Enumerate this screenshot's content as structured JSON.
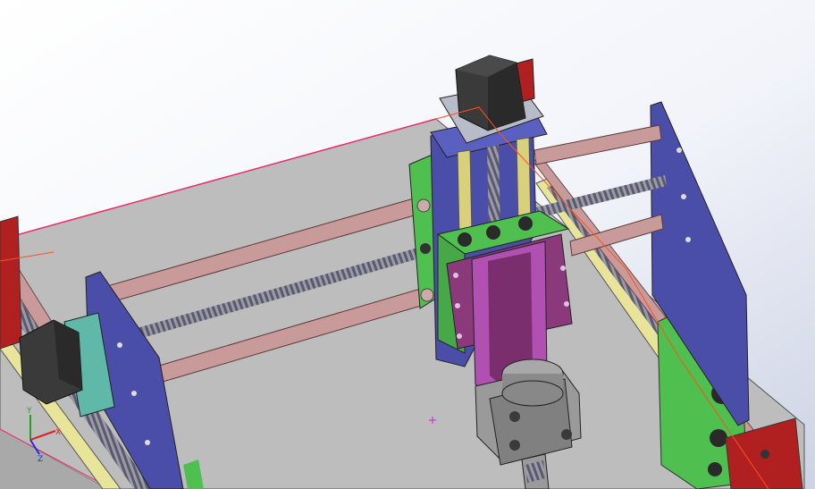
{
  "viewport": {
    "background_top": "#ffffff",
    "background_bottom": "#cdd3e4"
  },
  "triad": {
    "x_label": "X",
    "y_label": "Y",
    "z_label": "Z",
    "x_color": "#e02020",
    "y_color": "#20a020",
    "z_color": "#2030e0"
  },
  "colors": {
    "baseplate": "#bfbfbf",
    "frame_blue": "#4a4ea8",
    "block_green": "#4fbf4f",
    "carriage_purple": "#8a3a7a",
    "motor_dark": "#3a3a3a",
    "rod_pink": "#c99a9a",
    "rail_yellow": "#e8e49a",
    "endplate_red": "#b02020",
    "coupler_teal": "#5fb8a8",
    "spindle_gray": "#8c8c8c",
    "selection_line": "#e8306a",
    "sketch_line": "#ff5020",
    "origin_marker": "#d020d0"
  }
}
